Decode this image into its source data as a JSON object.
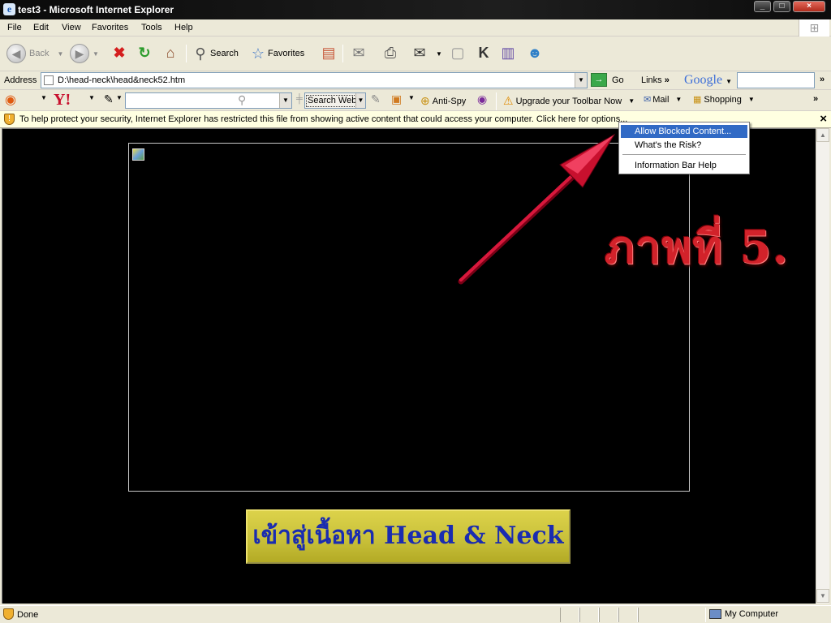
{
  "window": {
    "title": "test3 - Microsoft Internet Explorer",
    "controls": [
      "_",
      "□",
      "×"
    ]
  },
  "menu": [
    "File",
    "Edit",
    "View",
    "Favorites",
    "Tools",
    "Help"
  ],
  "toolbar": {
    "back": "Back",
    "search": "Search",
    "favorites": "Favorites"
  },
  "address": {
    "label": "Address",
    "value": "D:\\head-neck\\head&neck52.htm",
    "go": "Go",
    "links": "Links",
    "google": "Google"
  },
  "yahoo_toolbar": {
    "search_web": "Search Web",
    "anti_spy": "Anti-Spy",
    "upgrade": "Upgrade your Toolbar Now",
    "mail": "Mail",
    "shopping": "Shopping"
  },
  "infobar": {
    "message": "To help protect your security, Internet Explorer has restricted this file from showing active content that could access your computer. Click here for options..."
  },
  "context_menu": [
    "Allow Blocked Content...",
    "What's the Risk?",
    "Information Bar Help"
  ],
  "page": {
    "figure_label": "ภาพที่ 5.",
    "enter_button": "เข้าสู่เนื้อหา Head & Neck"
  },
  "status": {
    "text": "Done",
    "zone": "My Computer"
  },
  "colors": {
    "accent": "#d2222a",
    "highlight": "#316ac5",
    "button_text": "#1a2cb0"
  }
}
